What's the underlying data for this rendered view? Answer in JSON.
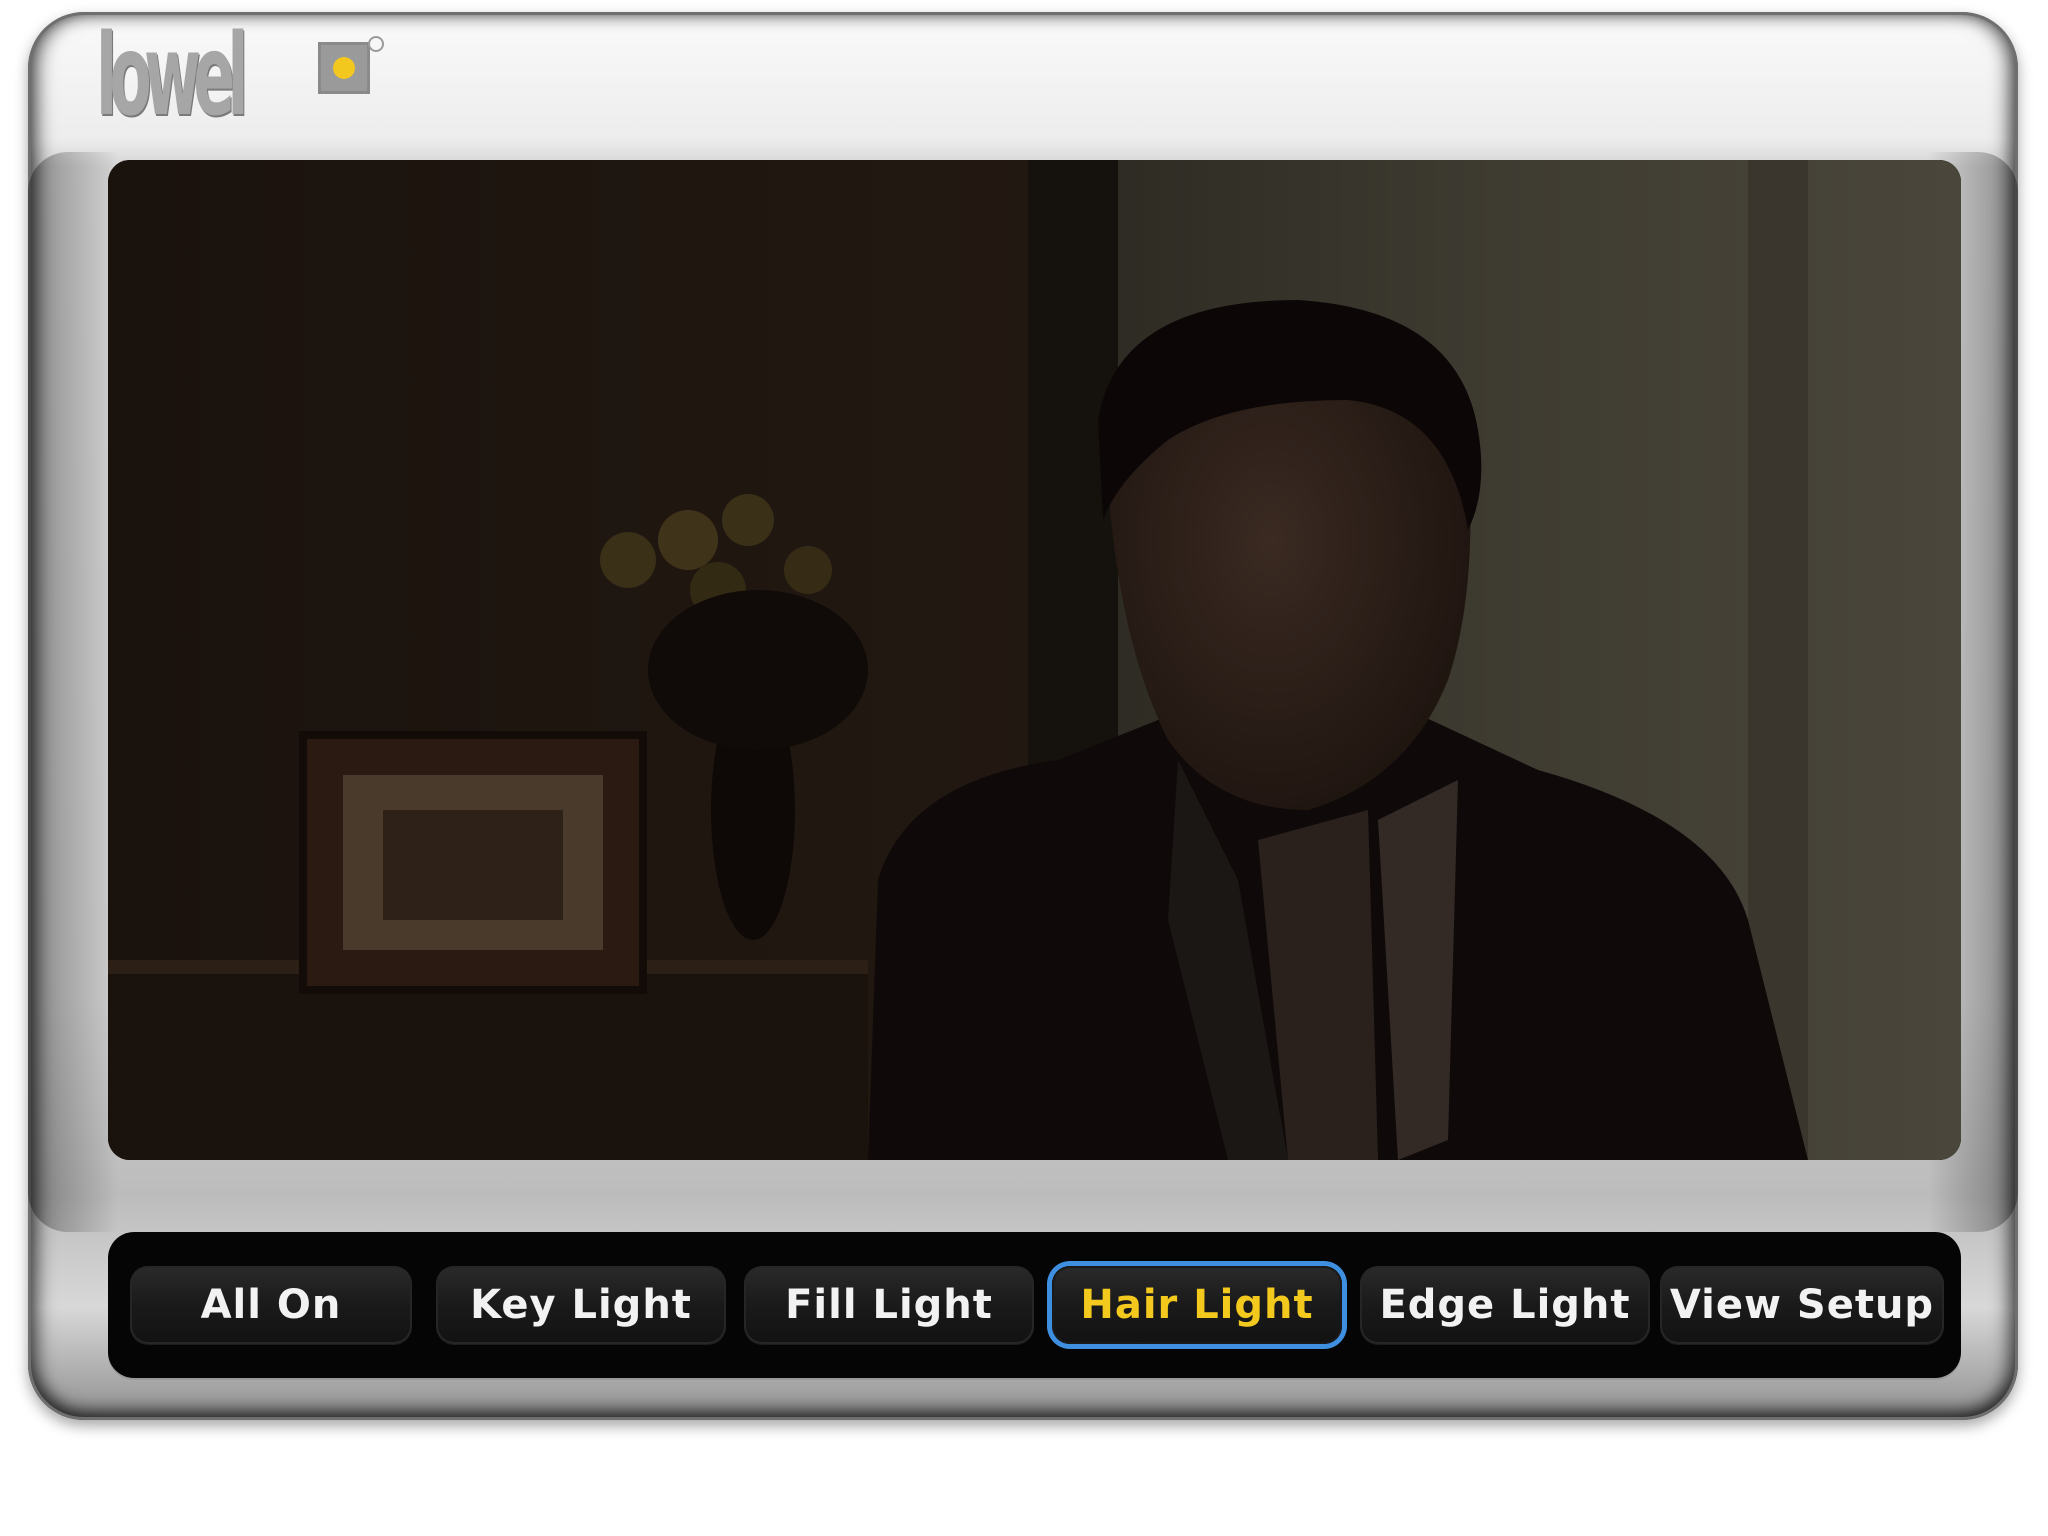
{
  "logo": {
    "text": "lowel",
    "accent_color": "#f2c81f"
  },
  "scene_image": {
    "description_icon": "video-still-icon"
  },
  "buttons": [
    {
      "label": "All On",
      "active": false
    },
    {
      "label": "Key Light",
      "active": false
    },
    {
      "label": "Fill Light",
      "active": false
    },
    {
      "label": "Hair Light",
      "active": true
    },
    {
      "label": "Edge Light",
      "active": false
    },
    {
      "label": "View Setup",
      "active": false
    }
  ],
  "colors": {
    "active_text": "#f3c91e",
    "active_border": "#3f8fe0",
    "button_text": "#f2f2f2"
  }
}
